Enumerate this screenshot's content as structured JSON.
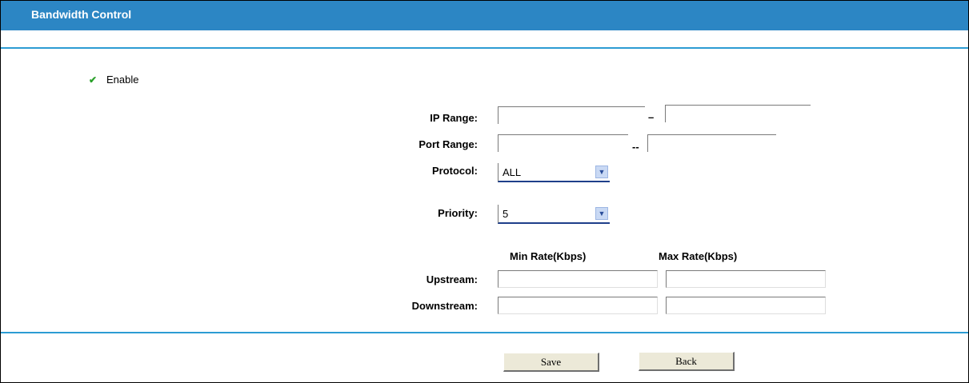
{
  "header": {
    "title": "Bandwidth Control"
  },
  "enable": {
    "label": "Enable",
    "checked": true
  },
  "form": {
    "ip_range": {
      "label": "IP Range:",
      "start": "",
      "end": "",
      "separator": "–"
    },
    "port_range": {
      "label": "Port Range:",
      "start": "",
      "end": "",
      "separator": "--"
    },
    "protocol": {
      "label": "Protocol:",
      "value": "ALL"
    },
    "priority": {
      "label": "Priority:",
      "value": "5"
    },
    "rate_headers": {
      "min": "Min Rate(Kbps)",
      "max": "Max Rate(Kbps)"
    },
    "upstream": {
      "label": "Upstream:",
      "min": "",
      "max": ""
    },
    "downstream": {
      "label": "Downstream:",
      "min": "",
      "max": ""
    }
  },
  "buttons": {
    "save": "Save",
    "back": "Back"
  },
  "colors": {
    "title_bar": "#2c86c4",
    "divider": "#2c9cd3",
    "check": "#2aa02a"
  }
}
